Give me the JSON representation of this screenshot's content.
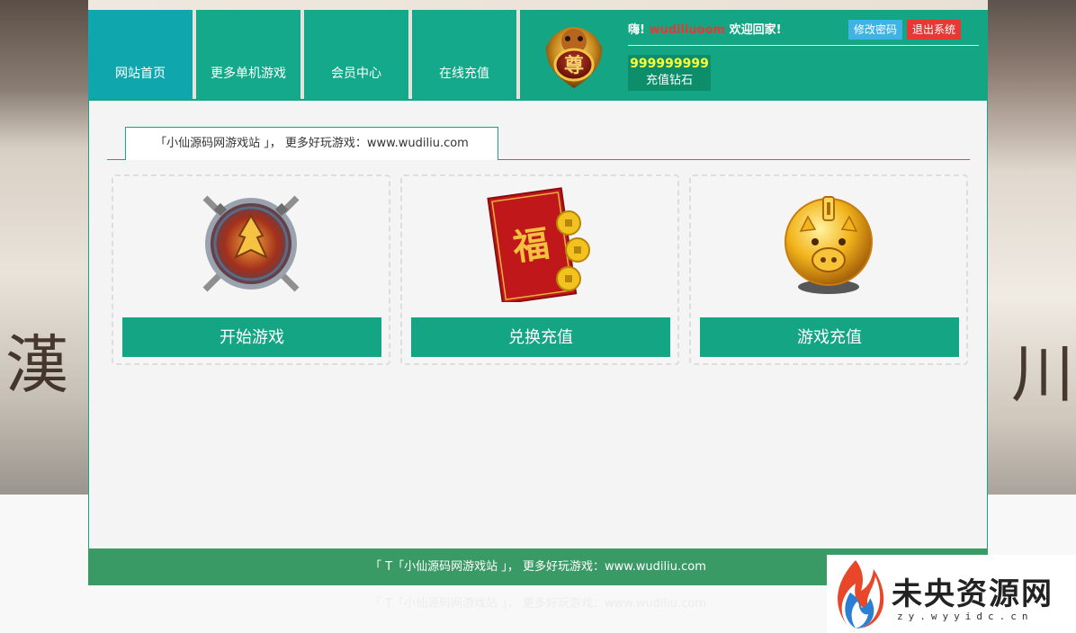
{
  "nav": {
    "items": [
      {
        "label": "网站首页"
      },
      {
        "label": "更多单机游戏"
      },
      {
        "label": "会员中心"
      },
      {
        "label": "在线充值"
      }
    ],
    "active_color": "#0fa7ad",
    "item_color": "#14a98a"
  },
  "user": {
    "greeting_prefix": "嗨!",
    "username": "wudiliuoom",
    "greeting_suffix": "欢迎回家!",
    "change_password": "修改密码",
    "logout": "退出系统",
    "diamond_value": "999999999",
    "diamond_label": "充值钻石",
    "avatar_glyph": "尊"
  },
  "content": {
    "tab_label": "「小仙源码网游戏站 」， 更多好玩游戏：www.wudiliu.com",
    "cards": [
      {
        "button": "开始游戏",
        "icon": "crossed-swords-emblem-icon"
      },
      {
        "button": "兑换充值",
        "icon": "red-envelope-fu-icon",
        "glyph": "福"
      },
      {
        "button": "游戏充值",
        "icon": "golden-piggy-bank-icon"
      }
    ]
  },
  "footer": {
    "text": "「 T「小仙源码网游戏站 」， 更多好玩游戏：www.wudiliu.com"
  },
  "background": {
    "left_glyph": "漢",
    "right_glyph": "川"
  },
  "watermark": {
    "title": "未央资源网",
    "subtitle": "zy.wyyidc.cn"
  },
  "colors": {
    "brand": "#13a584",
    "footer": "#3a9a65",
    "danger": "#e53935",
    "info": "#3fb3e6",
    "diamond": "#ffff33"
  }
}
